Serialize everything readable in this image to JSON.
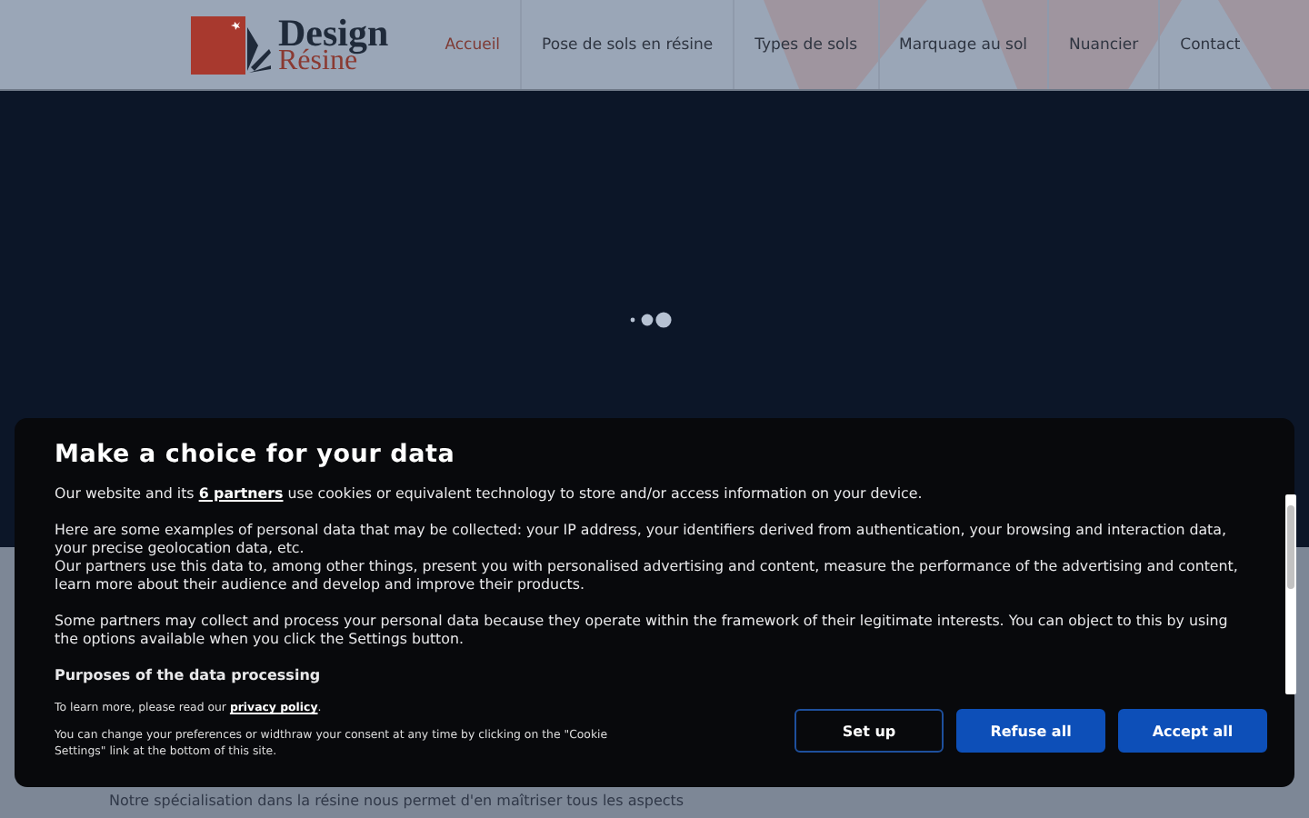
{
  "header": {
    "logo": {
      "word_1": "Design",
      "word_2": "Résine"
    },
    "nav": [
      {
        "label": "Accueil",
        "selected": true
      },
      {
        "label": "Pose de sols en résine",
        "selected": false
      },
      {
        "label": "Types de sols",
        "selected": false
      },
      {
        "label": "Marquage au sol",
        "selected": false
      },
      {
        "label": "Nuancier",
        "selected": false
      },
      {
        "label": "Contact",
        "selected": false
      }
    ]
  },
  "page_text": "Notre spécialisation dans la résine nous permet d'en maîtriser tous les aspects",
  "consent": {
    "title": "Make a choice for your data",
    "paragraphs": [
      {
        "kind": "intro",
        "before": "Our website and its ",
        "link": "6 partners",
        "after": " use cookies or equivalent technology to store and/or access information on your device."
      },
      {
        "kind": "text",
        "text": "Here are some examples of personal data that may be collected: your IP address, your identifiers derived from authentication, your browsing and interaction data, your precise geolocation data, etc."
      },
      {
        "kind": "text",
        "text": "Our partners use this data to, among other things, present you with personalised advertising and content, measure the performance of the advertising and content, learn more about their audience and develop and improve their products."
      },
      {
        "kind": "gap"
      },
      {
        "kind": "text",
        "text": "Some partners may collect and process your personal data because they operate within the framework of their legitimate interests. You can object to this by using the options available when you click the Settings button."
      },
      {
        "kind": "heading",
        "text": "Purposes of the data processing"
      }
    ],
    "learn_more": {
      "before": "To learn more, please read our ",
      "link": "privacy policy",
      "after": "."
    },
    "change_note": "You can change your preferences or widthraw your consent at any time by clicking on the \"Cookie Settings\" link at the bottom of this site.",
    "buttons": [
      {
        "label": "Set up",
        "kind": "outline"
      },
      {
        "label": "Refuse all",
        "kind": "filled"
      },
      {
        "label": "Accept all",
        "kind": "filled"
      }
    ]
  }
}
